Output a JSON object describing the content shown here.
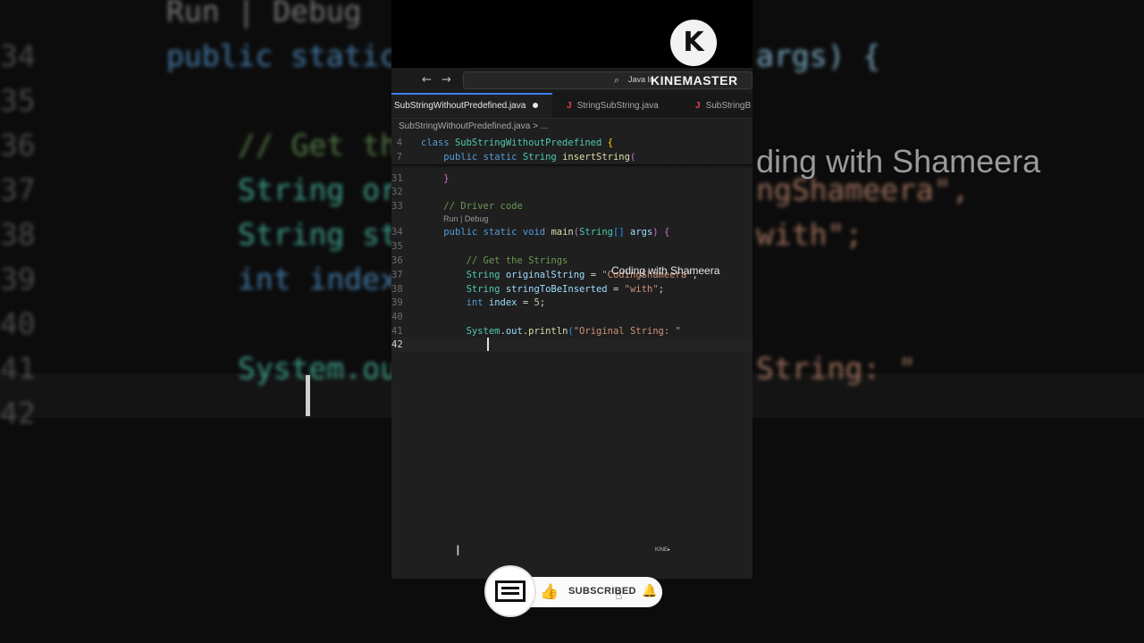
{
  "background": {
    "lines": [
      {
        "num": "",
        "code": "Run | Debug",
        "color": "#9a9a9a"
      },
      {
        "num": "34",
        "code": "public static",
        "color": "#569cd6",
        "right": "args) {",
        "rightColor": "#9cdcfe"
      },
      {
        "num": "35",
        "code": "",
        "color": "#569cd6"
      },
      {
        "num": "36",
        "code": "// Get th",
        "color": "#6a9955"
      },
      {
        "num": "37",
        "code": "String or",
        "color": "#4ec9b0",
        "right": "ngShameera\",",
        "rightColor": "#ce9178"
      },
      {
        "num": "38",
        "code": "String st",
        "color": "#4ec9b0",
        "right": "with\";",
        "rightColor": "#ce9178"
      },
      {
        "num": "39",
        "code": "int index",
        "color": "#569cd6"
      },
      {
        "num": "40",
        "code": "",
        "color": "#569cd6"
      },
      {
        "num": "41",
        "code": "System.ou",
        "color": "#4ec9b0",
        "right": "String: \"",
        "rightColor": "#ce9178"
      },
      {
        "num": "42",
        "code": "",
        "color": "#569cd6"
      }
    ],
    "watermark": "ding with Shameera"
  },
  "titlebar": {
    "back": "←",
    "forward": "→",
    "search_icon": "⌕",
    "search_text": "Java In"
  },
  "tabs": [
    {
      "label": "SubStringWithoutPredefined.java",
      "active": true,
      "modified": true
    },
    {
      "label": "StringSubString.java",
      "active": false,
      "modified": false
    },
    {
      "label": "SubStringB",
      "active": false,
      "modified": false
    }
  ],
  "tab_icon": "J",
  "breadcrumb": "SubStringWithoutPredefined.java > ...",
  "editor": {
    "codelens": "Run | Debug",
    "lines": [
      {
        "n": "4",
        "html": "<span class='kw'>class</span> <span class='ty'>SubStringWithoutPredefined</span> <span class='br'>{</span>"
      },
      {
        "n": "7",
        "html": "    <span class='kw'>public</span> <span class='kw'>static</span> <span class='ty'>String</span> <span class='fn'>insertString</span><span class='br2'>(</span>"
      },
      {
        "n": "31",
        "html": "    <span class='br2'>}</span>"
      },
      {
        "n": "32",
        "html": ""
      },
      {
        "n": "33",
        "html": "    <span class='cm'>// Driver code</span>"
      },
      {
        "n": "34",
        "html": "    <span class='kw'>public</span> <span class='kw'>static</span> <span class='kw'>void</span> <span class='fn'>main</span><span class='br2'>(</span><span class='ty'>String</span><span class='br3'>[]</span> <span class='va'>args</span><span class='br2'>)</span> <span class='br2'>{</span>"
      },
      {
        "n": "35",
        "html": ""
      },
      {
        "n": "36",
        "html": "        <span class='cm'>// Get the Strings</span>"
      },
      {
        "n": "37",
        "html": "        <span class='ty'>String</span> <span class='va'>originalString</span> <span class='pl'>=</span> <span class='st'>\"CodingShameera\"</span><span class='pl'>,</span>"
      },
      {
        "n": "38",
        "html": "        <span class='ty'>String</span> <span class='va'>stringToBeInserted</span> <span class='pl'>=</span> <span class='st'>\"with\"</span><span class='pl'>;</span>"
      },
      {
        "n": "39",
        "html": "        <span class='kw'>int</span> <span class='va'>index</span> <span class='pl'>=</span> <span class='nu'>5</span><span class='pl'>;</span>"
      },
      {
        "n": "40",
        "html": ""
      },
      {
        "n": "41",
        "html": "        <span class='ty'>System</span><span class='pl'>.</span><span class='va'>out</span><span class='pl'>.</span><span class='fn'>println</span><span class='br3'>(</span><span class='st'>\"Original String: \"</span>"
      },
      {
        "n": "42",
        "html": ""
      }
    ]
  },
  "overlay": {
    "kinemaster_logo": "K",
    "kinemaster_text": "KINEMASTER",
    "watermark": "Coding with Shameera",
    "small_mark": "KINE▸",
    "text_cursor": "I"
  },
  "subscribe": {
    "label": "SUBSCRIBED",
    "thumb_icon": "👍",
    "bell_icon": "🔔",
    "hand_icon": "☝"
  }
}
